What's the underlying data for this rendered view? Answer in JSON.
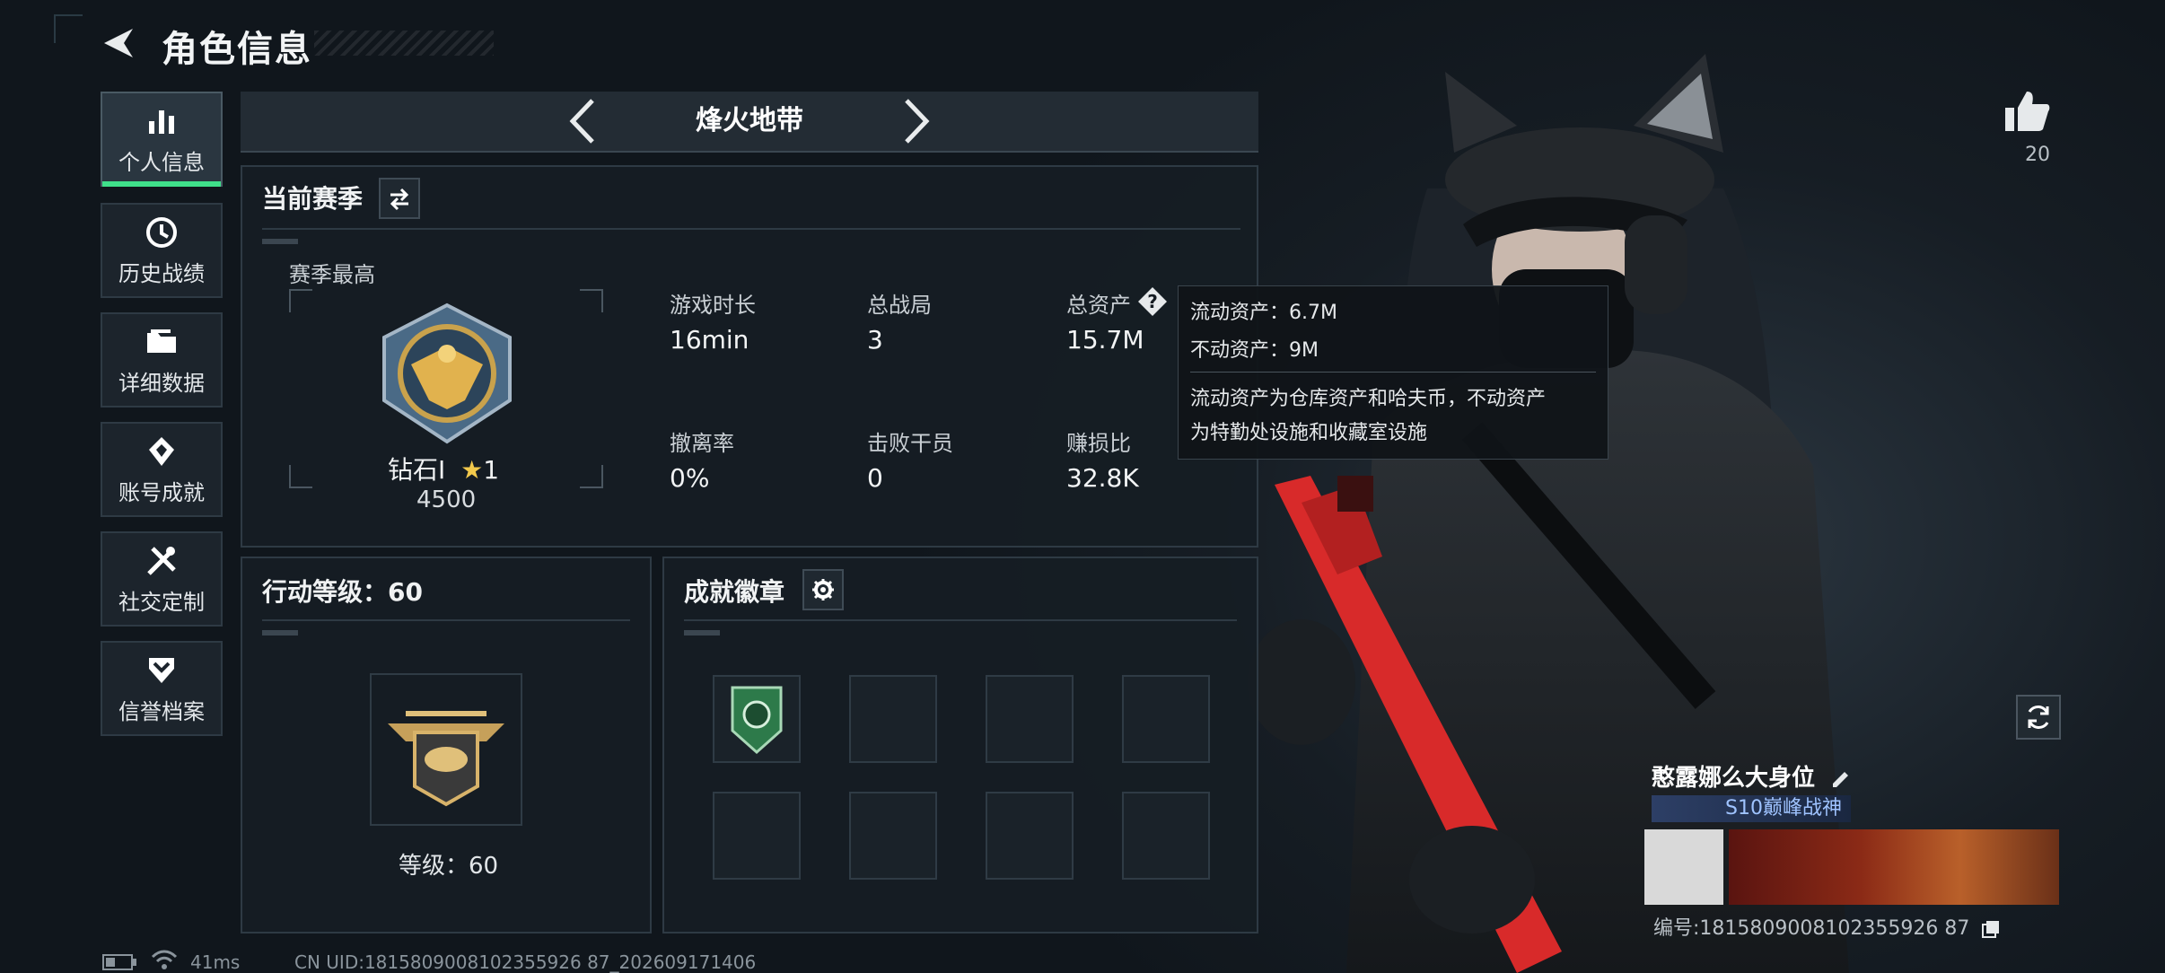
{
  "header": {
    "title": "角色信息"
  },
  "sidebar": {
    "items": [
      {
        "label": "个人信息",
        "icon": "bar-chart-icon",
        "active": true
      },
      {
        "label": "历史战绩",
        "icon": "clock-icon",
        "active": false
      },
      {
        "label": "详细数据",
        "icon": "folder-icon",
        "active": false
      },
      {
        "label": "账号成就",
        "icon": "medal-icon",
        "active": false
      },
      {
        "label": "社交定制",
        "icon": "tools-icon",
        "active": false
      },
      {
        "label": "信誉档案",
        "icon": "shield-chevron-icon",
        "active": false
      }
    ]
  },
  "mode": {
    "title": "烽火地带"
  },
  "season": {
    "title": "当前赛季",
    "best_label": "赛季最高",
    "rank_name": "钻石Ⅰ",
    "rank_stars": "1",
    "rank_score": "4500",
    "stats": [
      {
        "label": "游戏时长",
        "value": "16min"
      },
      {
        "label": "总战局",
        "value": "3"
      },
      {
        "label": "总资产",
        "value": "15.7M"
      },
      {
        "label": "撤离率",
        "value": "0%"
      },
      {
        "label": "击败干员",
        "value": "0"
      },
      {
        "label": "赚损比",
        "value": "32.8K"
      }
    ]
  },
  "tooltip": {
    "liquid": "流动资产：6.7M",
    "fixed": "不动资产：9M",
    "desc_line1": "流动资产为仓库资产和哈夫币，不动资产",
    "desc_line2": "为特勤处设施和收藏室设施"
  },
  "level": {
    "title": "行动等级：60",
    "caption": "等级：60"
  },
  "achievements": {
    "title": "成就徽章"
  },
  "profile": {
    "likes": "20",
    "name": "憨露娜么大身位",
    "title_badge": "S10巅峰战神",
    "id_text": "编号:1815809008102355926 87"
  },
  "status_bar": {
    "ping": "41ms",
    "uid": "CN UID:1815809008102355926 87_202609171406"
  },
  "colors": {
    "accent": "#3fe08a",
    "weapon": "#d82a2a"
  }
}
